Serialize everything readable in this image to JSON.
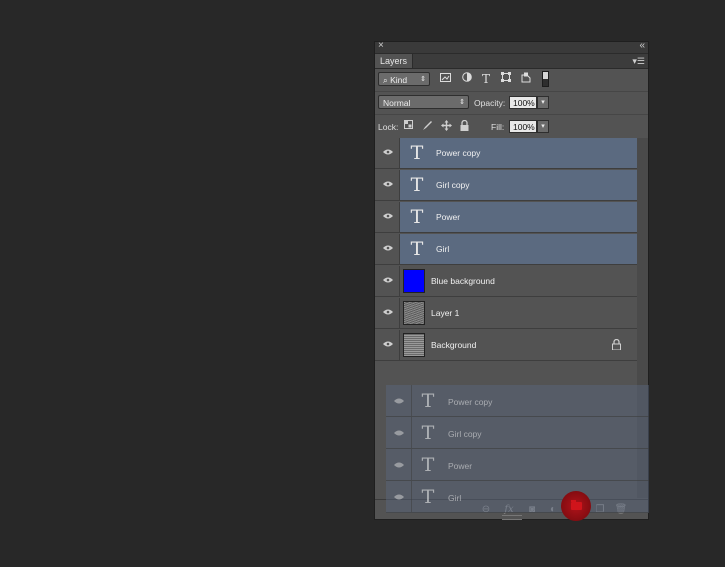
{
  "panel": {
    "tab_label": "Layers",
    "close_glyph": "×",
    "collapse_glyph": "«",
    "menu_glyph": "▾☰"
  },
  "filter": {
    "kind_label": "Kind",
    "arrow": "⇕",
    "icons": [
      "pixel-filter-icon",
      "adjustment-filter-icon",
      "type-filter-icon",
      "shape-filter-icon",
      "smart-object-filter-icon"
    ]
  },
  "blend": {
    "mode": "Normal",
    "opacity_label": "Opacity:",
    "opacity_value": "100%"
  },
  "lock": {
    "label": "Lock:",
    "fill_label": "Fill:",
    "fill_value": "100%"
  },
  "layers": [
    {
      "name": "Power copy",
      "type": "text",
      "selected": true
    },
    {
      "name": "Girl copy",
      "type": "text",
      "selected": true
    },
    {
      "name": "Power",
      "type": "text",
      "selected": true
    },
    {
      "name": "Girl",
      "type": "text",
      "selected": true
    },
    {
      "name": "Blue background",
      "type": "fill",
      "color": "#0000ff",
      "selected": false
    },
    {
      "name": "Layer 1",
      "type": "pattern",
      "selected": false
    },
    {
      "name": "Background",
      "type": "pattern",
      "selected": false,
      "locked": true
    }
  ],
  "drag_ghost": [
    "Power copy",
    "Girl copy",
    "Power",
    "Girl"
  ],
  "text_glyph": "T",
  "accent": "#5b6a80",
  "highlight_color": "#b0131a"
}
